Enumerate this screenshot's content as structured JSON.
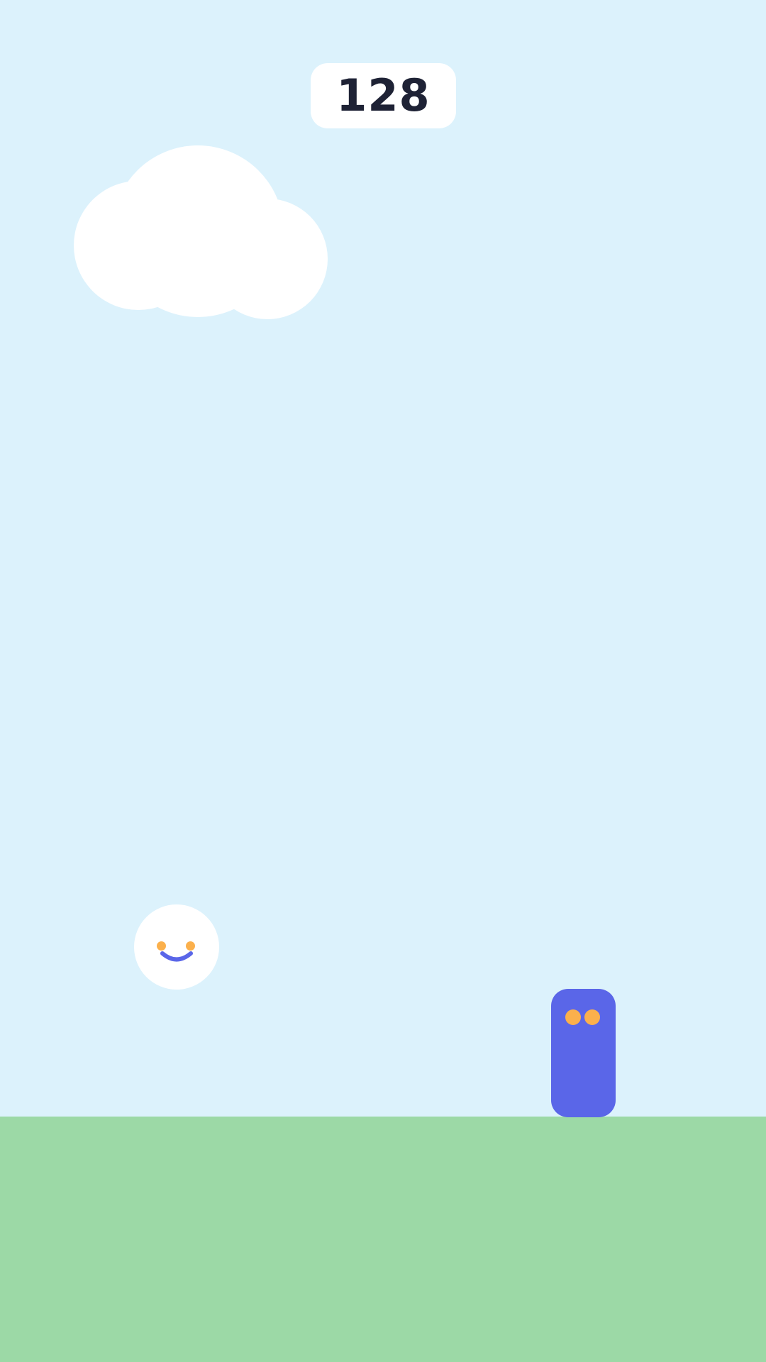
{
  "hud": {
    "score": "128"
  },
  "colors": {
    "sky": "#dcf2fc",
    "ground": "#9cd9a6",
    "cloud": "#ffffff",
    "player_body": "#ffffff",
    "player_eyes": "#fbb04c",
    "player_mouth": "#5a66e8",
    "obstacle_body": "#5a66e8",
    "obstacle_eyes": "#fbb04c",
    "score_text": "#1e2235"
  },
  "scene": {
    "clouds": 1,
    "player": "smiling-ball-character",
    "obstacles": [
      "purple-block-enemy"
    ]
  }
}
